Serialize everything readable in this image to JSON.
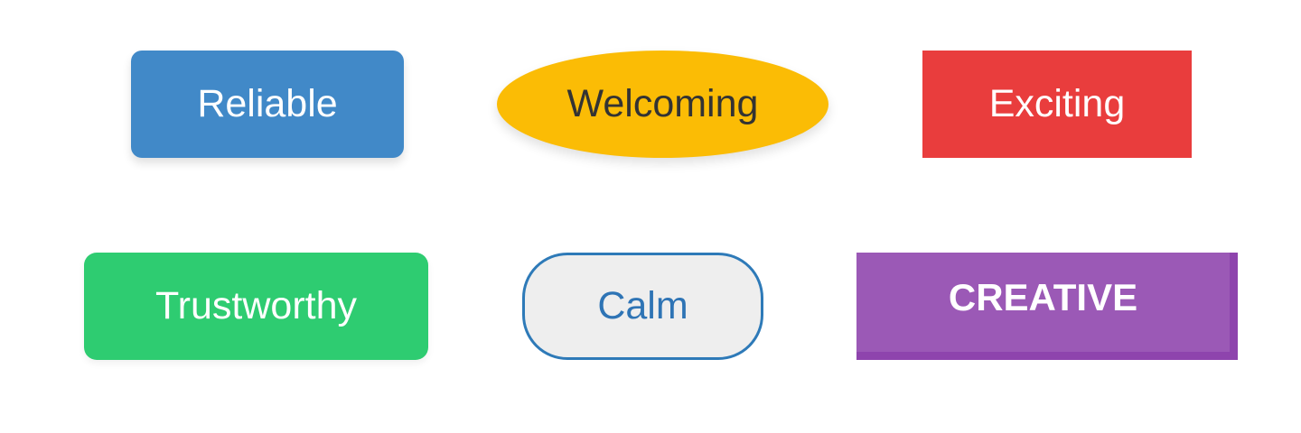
{
  "buttons": {
    "reliable": {
      "label": "Reliable",
      "color": "#4189c8"
    },
    "welcoming": {
      "label": "Welcoming",
      "color": "#fbbc05"
    },
    "exciting": {
      "label": "Exciting",
      "color": "#e93d3d"
    },
    "trustworthy": {
      "label": "Trustworthy",
      "color": "#2ecc71"
    },
    "calm": {
      "label": "Calm",
      "color": "#eeeeee",
      "border_color": "#2e7ab8"
    },
    "creative": {
      "label": "CREATIVE",
      "color": "#9b59b6",
      "shadow_color": "#8e44ad"
    }
  }
}
